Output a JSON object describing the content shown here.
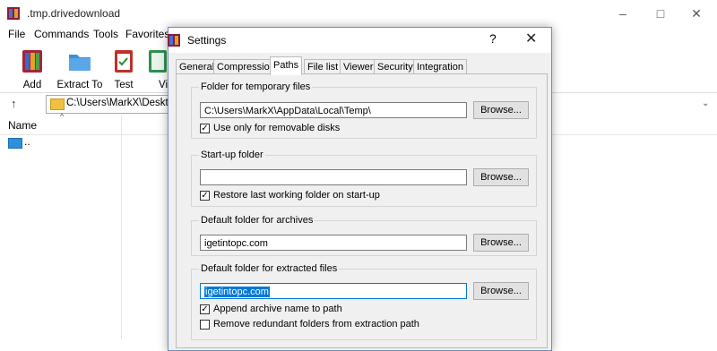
{
  "app": {
    "title": ".tmp.drivedownload",
    "menu": [
      "File",
      "Commands",
      "Tools",
      "Favorites"
    ],
    "toolbar": [
      {
        "label": "Add",
        "icon": "add-archive-icon"
      },
      {
        "label": "Extract To",
        "icon": "extract-folder-icon"
      },
      {
        "label": "Test",
        "icon": "test-clipboard-icon"
      },
      {
        "label": "Vi",
        "icon": "view-book-icon"
      }
    ],
    "address": "C:\\Users\\MarkX\\Desktop",
    "column_name": "Name",
    "sort_indicator": "^",
    "parent_item": ".."
  },
  "dialog": {
    "title": "Settings",
    "help_glyph": "?",
    "close_glyph": "✕",
    "tabs": [
      "General",
      "Compression",
      "Paths",
      "File list",
      "Viewer",
      "Security",
      "Integration"
    ],
    "active_tab": "Paths",
    "groups": {
      "temp": {
        "title": "Folder for temporary files",
        "value": "C:\\Users\\MarkX\\AppData\\Local\\Temp\\",
        "browse": "Browse...",
        "checkbox_label": "Use only for removable disks",
        "checked": true
      },
      "startup": {
        "title": "Start-up folder",
        "value": "",
        "browse": "Browse...",
        "checkbox_label": "Restore last working folder on start-up",
        "checked": true
      },
      "archives": {
        "title": "Default folder for archives",
        "value": "igetintopc.com",
        "browse": "Browse..."
      },
      "extracted": {
        "title": "Default folder for extracted files",
        "value": "igetintopc.com",
        "browse": "Browse...",
        "checkbox1_label": "Append archive name to path",
        "checkbox1_checked": true,
        "checkbox2_label": "Remove redundant folders from extraction path",
        "checkbox2_checked": false
      }
    }
  },
  "colors": {
    "accent": "#0078d7",
    "dialog_bg": "#f0f0f0",
    "button_bg": "#e1e1e1"
  }
}
